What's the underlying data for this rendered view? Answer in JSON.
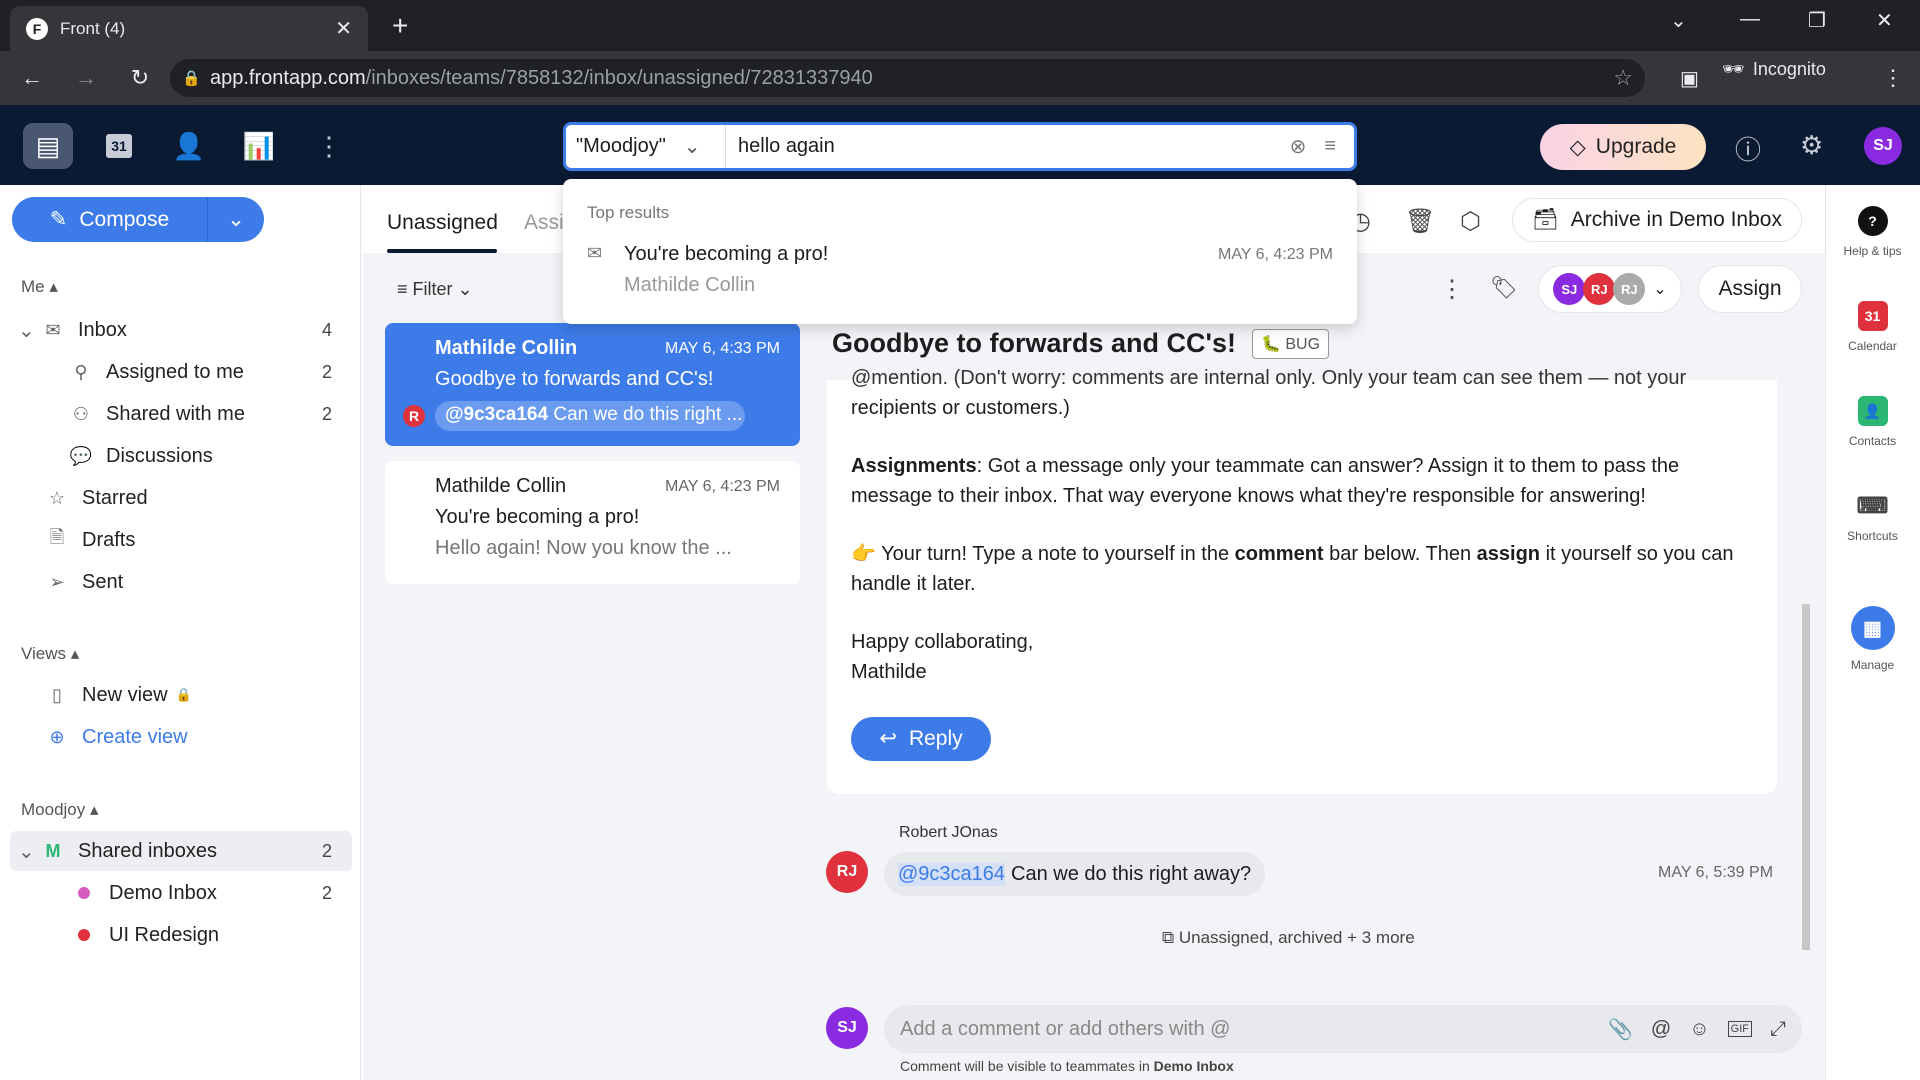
{
  "browser": {
    "tab_title": "Front (4)",
    "url_host": "app.frontapp.com",
    "url_path": "/inboxes/teams/7858132/inbox/unassigned/72831337940",
    "incognito_label": "Incognito"
  },
  "header": {
    "search_scope": "\"Moodjoy\"",
    "search_query": "hello again",
    "upgrade_label": "Upgrade",
    "user_initials": "SJ",
    "calendar_day": "31"
  },
  "search_results": {
    "heading": "Top results",
    "items": [
      {
        "subject": "You're becoming a pro!",
        "from": "Mathilde Collin",
        "time": "MAY 6, 4:23 PM"
      }
    ]
  },
  "sidebar": {
    "compose_label": "Compose",
    "me_label": "Me",
    "me_items": [
      {
        "label": "Inbox",
        "count": "4"
      },
      {
        "label": "Assigned to me",
        "count": "2"
      },
      {
        "label": "Shared with me",
        "count": "2"
      },
      {
        "label": "Discussions",
        "count": ""
      },
      {
        "label": "Starred",
        "count": ""
      },
      {
        "label": "Drafts",
        "count": ""
      },
      {
        "label": "Sent",
        "count": ""
      }
    ],
    "views_label": "Views",
    "views": [
      {
        "label": "New view"
      },
      {
        "label": "Create view"
      }
    ],
    "team_label": "Moodjoy",
    "team_badge": "M",
    "team_items": [
      {
        "label": "Shared inboxes",
        "count": "2"
      },
      {
        "label": "Demo Inbox",
        "count": "2",
        "color": "#d45bc0"
      },
      {
        "label": "UI Redesign",
        "count": "",
        "color": "#e0323e"
      }
    ]
  },
  "list": {
    "tabs": [
      "Unassigned",
      "Assi"
    ],
    "filter_label": "Filter",
    "conversations": [
      {
        "from": "Mathilde Collin",
        "time": "MAY 6, 4:33 PM",
        "subject": "Goodbye to forwards and CC's!",
        "mention": "@9c3ca164",
        "preview": "Can we do this right ...",
        "badge": "R",
        "selected": true
      },
      {
        "from": "Mathilde Collin",
        "time": "MAY 6, 4:23 PM",
        "subject": "You're becoming a pro!",
        "preview": "Hello again! Now you know the ...",
        "selected": false
      }
    ]
  },
  "conversation": {
    "archive_label": "Archive in Demo Inbox",
    "assign_label": "Assign",
    "assignees": [
      "SJ",
      "RJ",
      "RJ"
    ],
    "subject": "Goodbye to forwards and CC's!",
    "tag": "BUG",
    "body": {
      "line0": "@mention. (Don't worry: comments are internal only. Only your team can see them — not your",
      "line0b": "recipients or customers.)",
      "assign_bold": "Assignments",
      "assign_text": ": Got a message only your teammate can answer? Assign it to them to pass the message to their inbox. That way everyone knows what they're responsible for answering!",
      "turn_1": " Your turn! Type a note to yourself in the ",
      "turn_b1": "comment",
      "turn_2": " bar below. Then ",
      "turn_b2": "assign",
      "turn_3": " it yourself so you can handle it later.",
      "signoff": "Happy collaborating,",
      "signature": "Mathilde"
    },
    "reply_label": "Reply",
    "comment": {
      "author": "Robert JOnas",
      "initials": "RJ",
      "mention": "@9c3ca164",
      "text": "Can we do this right away?",
      "time": "MAY 6, 5:39 PM"
    },
    "activity": "Unassigned, archived + 3 more",
    "composer_placeholder": "Add a comment or add others with @",
    "composer_note": "Comment will be visible to teammates in ",
    "composer_note_inbox": "Demo Inbox",
    "composer_initials": "SJ"
  },
  "rail": [
    "Help & tips",
    "Calendar",
    "Contacts",
    "Shortcuts",
    "Manage"
  ],
  "colors": {
    "accent": "#3d7be8",
    "header_bg": "#0b1a33",
    "sj": "#8a2be2",
    "rj": "#e0323e"
  }
}
